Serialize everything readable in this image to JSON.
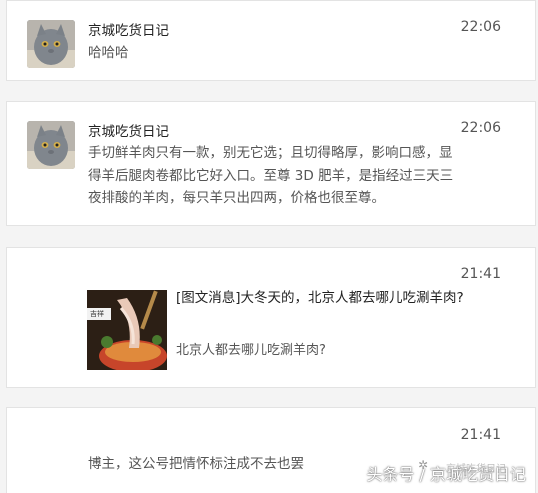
{
  "messages": [
    {
      "sender": "京城吃货日记",
      "time": "22:06",
      "text": "哈哈哈"
    },
    {
      "sender": "京城吃货日记",
      "time": "22:06",
      "text": "手切鲜羊肉只有一款，别无它选；且切得略厚，影响口感，显得羊后腿肉卷都比它好入口。至尊 3D 肥羊，是指经过三天三夜排酸的羊肉，每只羊只出四两，价格也很至尊。"
    },
    {
      "time": "21:41",
      "thumbnail_label": "吉祥",
      "article_title": "[图文消息]大冬天的，北京人都去哪儿吃涮羊肉?",
      "article_subtitle": "北京人都去哪儿吃涮羊肉?"
    },
    {
      "time": "21:41",
      "text": "博主，这公号把情怀标注成不去也罢"
    }
  ],
  "watermark": {
    "text": "头条号 / 京城吃货日记",
    "small_text": "京城吃货日记"
  },
  "colors": {
    "background": "#f4f4f4",
    "card": "#ffffff",
    "border": "#e3e3e3"
  }
}
